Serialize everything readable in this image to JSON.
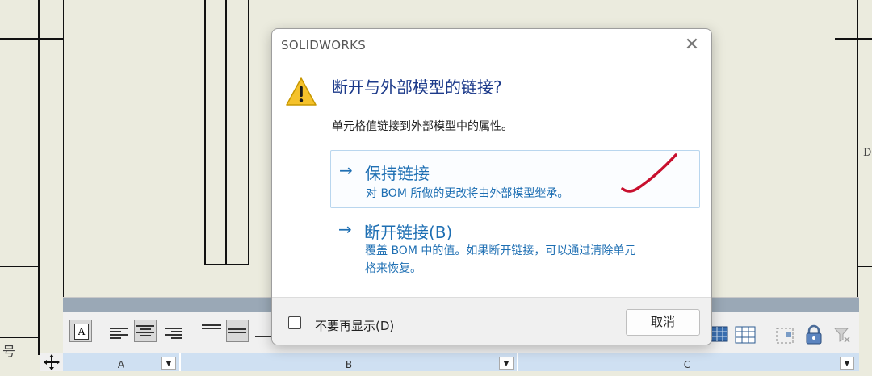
{
  "dialog": {
    "title": "SOLIDWORKS",
    "close_glyph": "✕",
    "main_instruction": "断开与外部模型的链接?",
    "content": "单元格值链接到外部模型中的属性。",
    "options": [
      {
        "label": "保持链接",
        "note": "对 BOM 所做的更改将由外部模型继承。"
      },
      {
        "label": "断开链接(B)",
        "note_line1": "覆盖 BOM 中的值。如果断开链接，可以通过清除单元",
        "note_line2": "格来恢复。"
      }
    ],
    "checkbox_label": "不要再显示(D)",
    "checkbox_checked": false,
    "cancel_label": "取消",
    "arrow_glyph": "→",
    "icon": "warning-icon"
  },
  "drawing": {
    "side_char": "号",
    "right_edge_char": "D",
    "column_headers": [
      "A",
      "B",
      "C"
    ],
    "dropdown_glyph": "▼"
  },
  "toolbar": {
    "text_style_glyph": "A"
  },
  "colors": {
    "link_blue": "#1e6fb3",
    "instruction_blue": "#1c3a8a",
    "annotation_red": "#c8102e"
  }
}
